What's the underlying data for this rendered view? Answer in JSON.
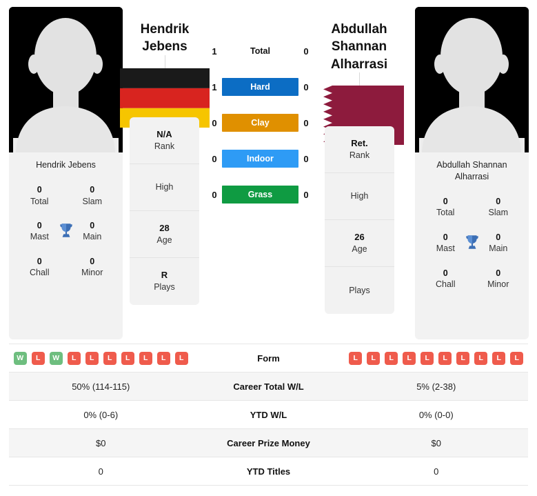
{
  "players": {
    "left": {
      "name_display": [
        "Hendrik",
        "Jebens"
      ],
      "card_name": "Hendrik Jebens",
      "flag": "germany-flag",
      "photo": "player-photo-placeholder",
      "titles": [
        {
          "value": "0",
          "label": "Total"
        },
        {
          "value": "0",
          "label": "Slam"
        },
        {
          "value": "0",
          "label": "Mast"
        },
        {
          "value": "0",
          "label": "Main"
        },
        {
          "value": "0",
          "label": "Chall"
        },
        {
          "value": "0",
          "label": "Minor"
        }
      ],
      "info": [
        {
          "value": "N/A",
          "label": "Rank"
        },
        {
          "value": "",
          "label": "High"
        },
        {
          "value": "28",
          "label": "Age"
        },
        {
          "value": "R",
          "label": "Plays"
        }
      ],
      "form": [
        "W",
        "L",
        "W",
        "L",
        "L",
        "L",
        "L",
        "L",
        "L",
        "L"
      ],
      "career_total_wl": "50% (114-115)",
      "ytd_wl": "0% (0-6)",
      "career_prize_money": "$0",
      "ytd_titles": "0"
    },
    "right": {
      "name_display": [
        "Abdullah",
        "Shannan",
        "Alharrasi"
      ],
      "card_name": "Abdullah Shannan Alharrasi",
      "flag": "qatar-flag",
      "photo": "player-photo-placeholder",
      "titles": [
        {
          "value": "0",
          "label": "Total"
        },
        {
          "value": "0",
          "label": "Slam"
        },
        {
          "value": "0",
          "label": "Mast"
        },
        {
          "value": "0",
          "label": "Main"
        },
        {
          "value": "0",
          "label": "Chall"
        },
        {
          "value": "0",
          "label": "Minor"
        }
      ],
      "info": [
        {
          "value": "Ret.",
          "label": "Rank"
        },
        {
          "value": "",
          "label": "High"
        },
        {
          "value": "26",
          "label": "Age"
        },
        {
          "value": "",
          "label": "Plays"
        }
      ],
      "form": [
        "L",
        "L",
        "L",
        "L",
        "L",
        "L",
        "L",
        "L",
        "L",
        "L"
      ],
      "career_total_wl": "5% (2-38)",
      "ytd_wl": "0% (0-0)",
      "career_prize_money": "$0",
      "ytd_titles": "0"
    }
  },
  "h2h_surfaces": [
    {
      "label": "Total",
      "left": "1",
      "right": "0",
      "style": "plain",
      "color": ""
    },
    {
      "label": "Hard",
      "left": "1",
      "right": "0",
      "style": "bar",
      "color": "#0c6dc4"
    },
    {
      "label": "Clay",
      "left": "0",
      "right": "0",
      "style": "bar",
      "color": "#e09000"
    },
    {
      "label": "Indoor",
      "left": "0",
      "right": "0",
      "style": "bar",
      "color": "#2e9bf5"
    },
    {
      "label": "Grass",
      "left": "0",
      "right": "0",
      "style": "bar",
      "color": "#0f9b42"
    }
  ],
  "stats_rows": [
    {
      "label": "Form",
      "key": "form",
      "type": "form"
    },
    {
      "label": "Career Total W/L",
      "key": "career_total_wl",
      "type": "text"
    },
    {
      "label": "YTD W/L",
      "key": "ytd_wl",
      "type": "text"
    },
    {
      "label": "Career Prize Money",
      "key": "career_prize_money",
      "type": "text"
    },
    {
      "label": "YTD Titles",
      "key": "ytd_titles",
      "type": "text"
    }
  ],
  "colors": {
    "win_badge": "#6ebe7f",
    "loss_badge": "#ef5b4c",
    "card_bg": "#f2f2f2",
    "trophy": "#3c6fb5"
  }
}
